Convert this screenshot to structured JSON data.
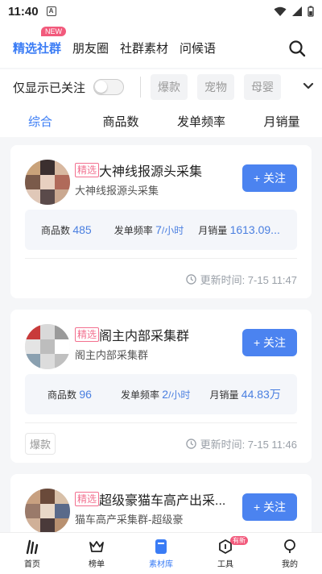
{
  "status_bar": {
    "time": "11:40",
    "notification_icon": "A"
  },
  "top_tabs": {
    "items": [
      {
        "label": "精选社群",
        "active": true,
        "badge": "NEW"
      },
      {
        "label": "朋友圈"
      },
      {
        "label": "社群素材"
      },
      {
        "label": "问候语"
      }
    ]
  },
  "filter": {
    "label": "仅显示已关注",
    "toggle_on": false,
    "chips": [
      "爆款",
      "宠物",
      "母婴"
    ]
  },
  "sort": {
    "items": [
      "综合",
      "商品数",
      "发单频率",
      "月销量"
    ],
    "active_index": 0
  },
  "cards": [
    {
      "tag": "精选",
      "title": "大神线报源头采集",
      "subtitle": "大神线报源头采集",
      "follow_label": "+ 关注",
      "stats": {
        "products_label": "商品数",
        "products_value": "485",
        "freq_label": "发单频率",
        "freq_value": "7",
        "freq_unit": "/小时",
        "sales_label": "月销量",
        "sales_value": "1613.09..."
      },
      "update_text": "更新时间:  7-15 11:47",
      "tag_pill": ""
    },
    {
      "tag": "精选",
      "title": "阁主内部采集群",
      "subtitle": "阁主内部采集群",
      "follow_label": "+ 关注",
      "stats": {
        "products_label": "商品数",
        "products_value": "96",
        "freq_label": "发单频率",
        "freq_value": "2",
        "freq_unit": "/小时",
        "sales_label": "月销量",
        "sales_value": "44.83万"
      },
      "update_text": "更新时间:  7-15 11:46",
      "tag_pill": "爆款"
    },
    {
      "tag": "精选",
      "title": "超级豪猫车高产出采...",
      "subtitle": "猫车高产采集群-超级豪",
      "follow_label": "+ 关注"
    }
  ],
  "bottom_nav": {
    "items": [
      {
        "label": "首页",
        "icon": "home-icon"
      },
      {
        "label": "榜单",
        "icon": "crown-icon"
      },
      {
        "label": "素材库",
        "icon": "material-icon",
        "active": true
      },
      {
        "label": "工具",
        "icon": "tool-icon",
        "badge": "有新"
      },
      {
        "label": "我的",
        "icon": "profile-icon"
      }
    ]
  },
  "colors": {
    "accent": "#3a7cf5",
    "tag": "#f2708f",
    "button": "#4b83f0"
  }
}
